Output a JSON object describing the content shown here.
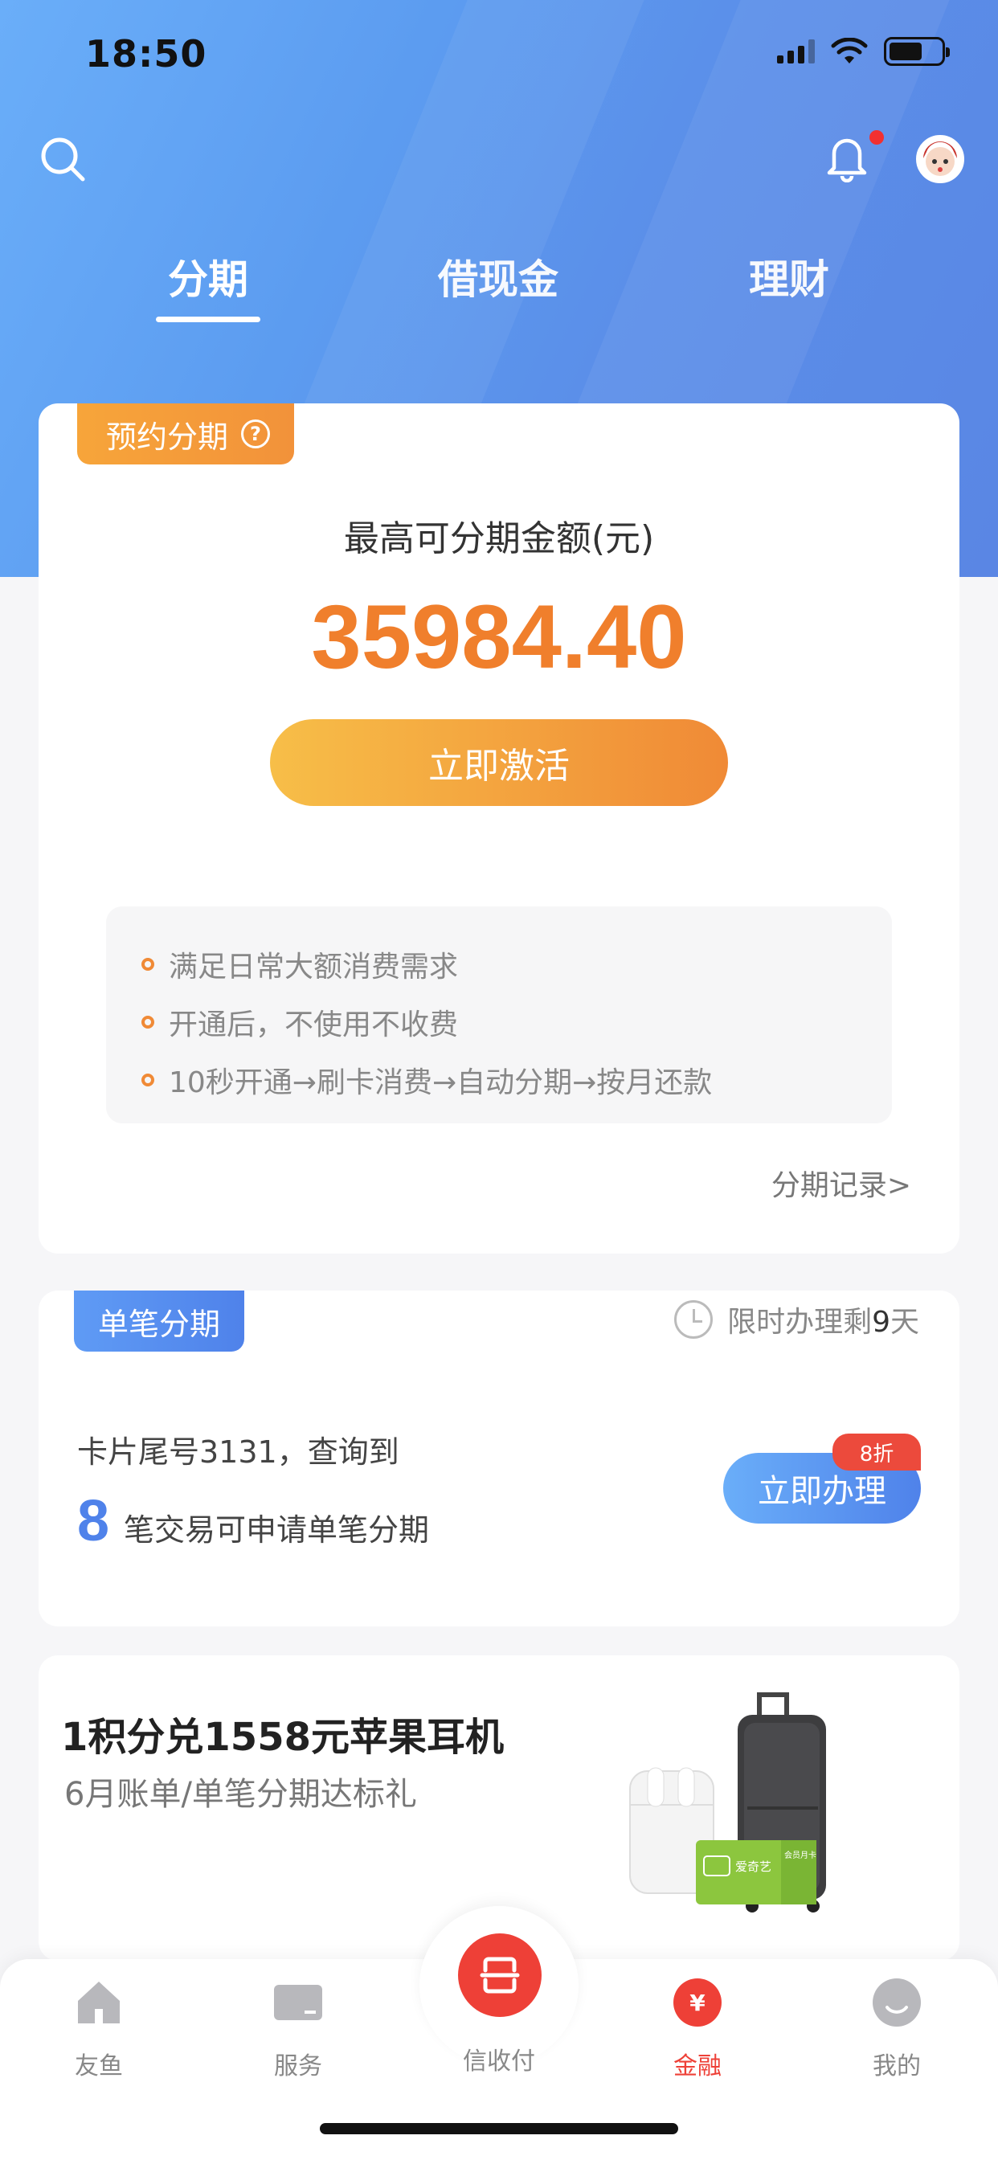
{
  "status_bar": {
    "time": "18:50"
  },
  "header": {
    "tabs": [
      {
        "label": "分期"
      },
      {
        "label": "借现金"
      },
      {
        "label": "理财"
      }
    ]
  },
  "installment_card": {
    "tag_label": "预约分期",
    "tag_help": "?",
    "max_label": "最高可分期金额(元)",
    "max_amount": "35984.40",
    "activate_label": "立即激活",
    "benefits": [
      "满足日常大额消费需求",
      "开通后，不使用不收费",
      "10秒开通→刷卡消费→自动分期→按月还款"
    ],
    "record_link": "分期记录>"
  },
  "single_card": {
    "tag_label": "单笔分期",
    "limit_prefix": "限时办理剩",
    "limit_days": "9",
    "limit_suffix": "天",
    "line1": "卡片尾号3131，查询到",
    "count": "8",
    "line2": "笔交易可申请单笔分期",
    "apply_label": "立即办理",
    "discount": "8折"
  },
  "promo": {
    "title": "1积分兑1558元苹果耳机",
    "subtitle": "6月账单/单笔分期达标礼",
    "card_text": "爱奇艺",
    "card_badge": "会员月卡"
  },
  "bottom_nav": {
    "items": [
      {
        "label": "友鱼"
      },
      {
        "label": "服务"
      },
      {
        "label": "信收付"
      },
      {
        "label": "金融"
      },
      {
        "label": "我的"
      }
    ],
    "active_color": "#ee4037"
  },
  "colors": {
    "accent_orange": "#f07f2c",
    "accent_blue": "#4f82ea",
    "header_blue": "#5c9cf0"
  }
}
